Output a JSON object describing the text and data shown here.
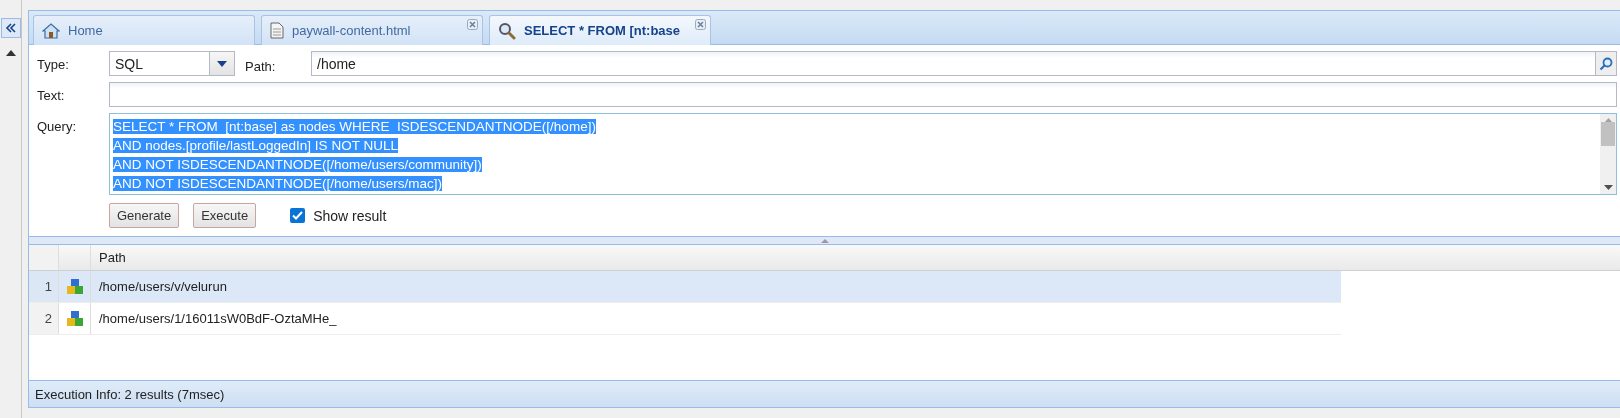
{
  "tabs": [
    {
      "label": "Home",
      "kind": "home",
      "closable": false,
      "selected": false
    },
    {
      "label": "paywall-content.html",
      "kind": "document",
      "closable": true,
      "selected": false
    },
    {
      "label": "SELECT * FROM [nt:base",
      "kind": "query",
      "closable": true,
      "selected": true
    }
  ],
  "form": {
    "type_label": "Type:",
    "type_value": "SQL",
    "path_label": "Path:",
    "path_value": "/home",
    "text_label": "Text:",
    "query_label": "Query:",
    "query_lines": [
      "SELECT * FROM  [nt:base] as nodes WHERE  ISDESCENDANTNODE([/home])",
      "AND nodes.[profile/lastLoggedIn] IS NOT NULL",
      "AND NOT ISDESCENDANTNODE([/home/users/community])",
      "AND NOT ISDESCENDANTNODE([/home/users/mac])"
    ],
    "query_selected": true,
    "buttons": [
      "Generate",
      "Execute"
    ],
    "show_result": {
      "label": "Show result",
      "checked": true
    }
  },
  "grid": {
    "columns": [
      "Path"
    ],
    "rows": [
      {
        "number": "1",
        "path": "/home/users/v/velurun",
        "selected": true
      },
      {
        "number": "2",
        "path": "/home/users/1/16011sW0BdF-OztaMHe_",
        "selected": false
      }
    ]
  },
  "status_bar": "Execution Info: 2 results (7msec)"
}
